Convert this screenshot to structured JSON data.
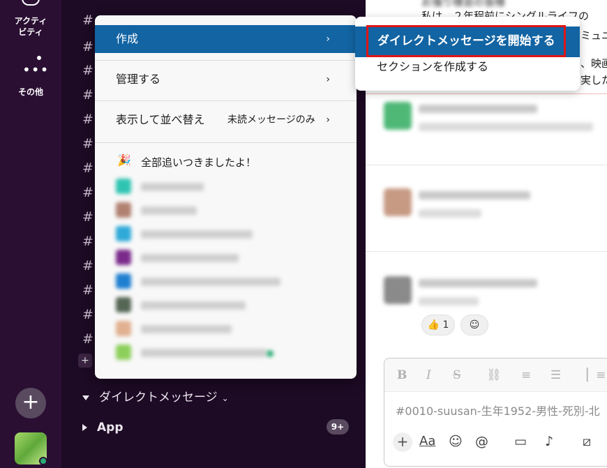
{
  "rail": {
    "activity_label": "アクティ\nビティ",
    "more_label": "その他",
    "add_icon": "plus-icon",
    "workspace_icon": "workspace-icon"
  },
  "sidebar": {
    "dm_section_label": "ダイレクトメッセージ",
    "app_section_label": "App",
    "app_badge": "9+"
  },
  "context_menu": {
    "create_label": "作成",
    "manage_label": "管理する",
    "display_sort_label": "表示して並べ替え",
    "display_sort_value": "未読メッセージのみ",
    "caught_up_text": "全部追いつきましたよ！"
  },
  "submenu": {
    "start_dm_label": "ダイレクトメッセージを開始する",
    "create_section_label": "セクションを作成する"
  },
  "content": {
    "top_line1": "お強り様会の皆様",
    "top_line2": "私は、２年程前にシングルライフの",
    "top_line3": "ミュニ",
    "top_line4": "、映画",
    "top_line5": "実した",
    "reaction_count": "1",
    "composer_placeholder": "#0010-suusan-生年1952-男性-死別-北"
  },
  "colors": {
    "rail_bg": "#2a0f33",
    "sidebar_bg": "#1d0a24",
    "menu_highlight": "#1264a3",
    "annotation_red": "#e01515"
  }
}
